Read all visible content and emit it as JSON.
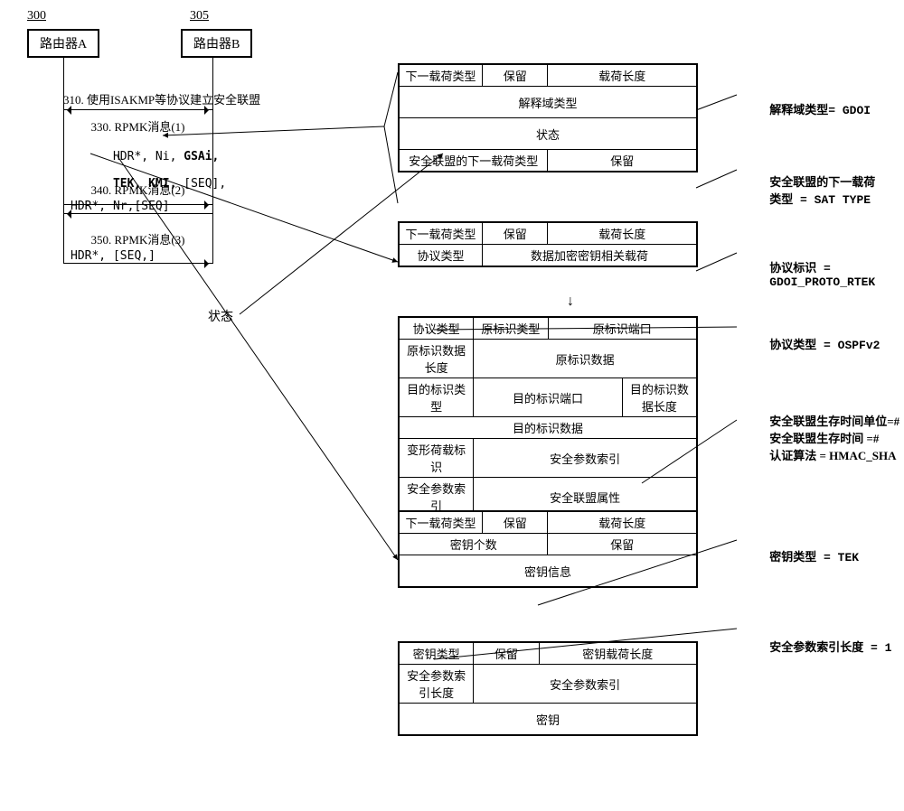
{
  "labels": {
    "l300": "300",
    "l305": "305",
    "routerA": "路由器A",
    "routerB": "路由器B",
    "statusWord": "状态"
  },
  "seq": {
    "step310": {
      "caption": "310. 使用ISAKMP等协议建立安全联盟"
    },
    "step330": {
      "caption": "330. RPMK消息(1)",
      "body_plain": "HDR*, Ni, ",
      "body_bold1": "GSAi,",
      "body_bold2": "TEK, KMI,",
      "body_tail": " [SEQ],"
    },
    "step340": {
      "caption": "340. RPMK消息(2)",
      "body": "HDR*, Nr,[SEQ]"
    },
    "step350": {
      "caption": "350. RPMK消息(3)",
      "body": "HDR*, [SEQ,]"
    }
  },
  "blk1": {
    "c1": "下一载荷类型",
    "c2": "保留",
    "c3": "载荷长度",
    "r2": "解释域类型",
    "r3": "状态",
    "r4a": "安全联盟的下一载荷类型",
    "r4b": "保留"
  },
  "blk2": {
    "c1": "下一载荷类型",
    "c2": "保留",
    "c3": "载荷长度",
    "r2a": "协议类型",
    "r2b": "数据加密密钥相关载荷"
  },
  "blk3": {
    "r1a": "协议类型",
    "r1b": "原标识类型",
    "r1c": "原标识端口",
    "r2a": "原标识数据长度",
    "r2b": "原标识数据",
    "r3a": "目的标识类型",
    "r3b": "目的标识端口",
    "r3c": "目的标识数据长度",
    "r4": "目的标识数据",
    "r5a": "变形荷载标识",
    "r5b": "安全参数索引",
    "r6a": "安全参数索引",
    "r6b": "安全联盟属性"
  },
  "blk4": {
    "c1": "下一载荷类型",
    "c2": "保留",
    "c3": "载荷长度",
    "r2a": "密钥个数",
    "r2b": "保留",
    "r3": "密钥信息"
  },
  "blk5": {
    "r1a": "密钥类型",
    "r1b": "保留",
    "r1c": "密钥载荷长度",
    "r2a": "安全参数索引长度",
    "r2b": "安全参数索引",
    "r3": "密钥"
  },
  "ann": {
    "a1_lhs": "解释域类型",
    "a1_rhs": "= GDOI",
    "a2_lhs1": "安全联盟的下一载荷",
    "a2_lhs2": "类型",
    "a2_rhs": " = SAT TYPE",
    "a3_lhs": "协议标识",
    "a3_rhs": " =\nGDOI_PROTO_RTEK",
    "a4_lhs": "协议类型",
    "a4_rhs": " = OSPFv2",
    "a5_l1": "安全联盟生存时间单位=#",
    "a5_l2": "安全联盟生存时间 =#",
    "a5_l3": "认证算法 = HMAC_SHA",
    "a6_lhs": "密钥类型",
    "a6_rhs": " = TEK",
    "a7_lhs": "安全参数索引长度",
    "a7_rhs": " = 1"
  },
  "downArrow": "↓"
}
